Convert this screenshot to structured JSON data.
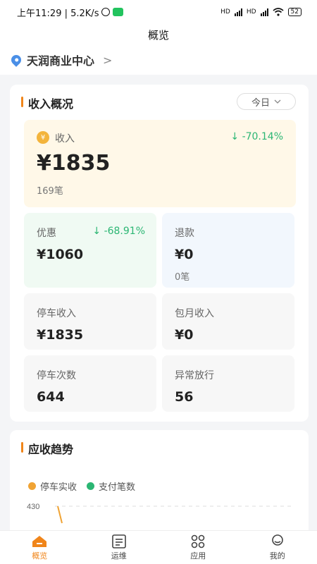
{
  "status_bar": {
    "time_text": "上午11:29 | 5.2K/s",
    "battery": "52",
    "signal_label": "HD"
  },
  "header": {
    "title": "概览"
  },
  "location": {
    "name": "天润商业中心"
  },
  "income": {
    "section_title": "收入概况",
    "period_select": "今日",
    "main": {
      "label": "收入",
      "change": "-70.14%",
      "value": "¥1835",
      "count": "169笔"
    },
    "discount": {
      "label": "优惠",
      "change": "-68.91%",
      "value": "¥1060"
    },
    "refund": {
      "label": "退款",
      "value": "¥0",
      "count": "0笔"
    },
    "parking_income": {
      "label": "停车收入",
      "value": "¥1835"
    },
    "monthly_income": {
      "label": "包月收入",
      "value": "¥0"
    },
    "parking_count": {
      "label": "停车次数",
      "value": "644"
    },
    "abnormal_release": {
      "label": "异常放行",
      "value": "56"
    }
  },
  "trend": {
    "section_title": "应收趋势",
    "legend": [
      {
        "name": "停车实收",
        "color": "#f0a334"
      },
      {
        "name": "支付笔数",
        "color": "#2bb673"
      }
    ]
  },
  "chart_data": {
    "type": "line",
    "title": "应收趋势",
    "y_tick_labels": [
      "430"
    ],
    "ylim_top": 430,
    "series": [
      {
        "name": "停车实收",
        "color": "#f0a334"
      },
      {
        "name": "支付笔数",
        "color": "#2bb673"
      }
    ],
    "grid": "dashed"
  },
  "tabbar": {
    "items": [
      {
        "label": "概览",
        "icon": "home-icon",
        "active": true
      },
      {
        "label": "运维",
        "icon": "list-icon",
        "active": false
      },
      {
        "label": "应用",
        "icon": "grid-icon",
        "active": false
      },
      {
        "label": "我的",
        "icon": "user-icon",
        "active": false
      }
    ]
  },
  "colors": {
    "accent": "#f0851a",
    "positive_down": "#2bb673"
  }
}
